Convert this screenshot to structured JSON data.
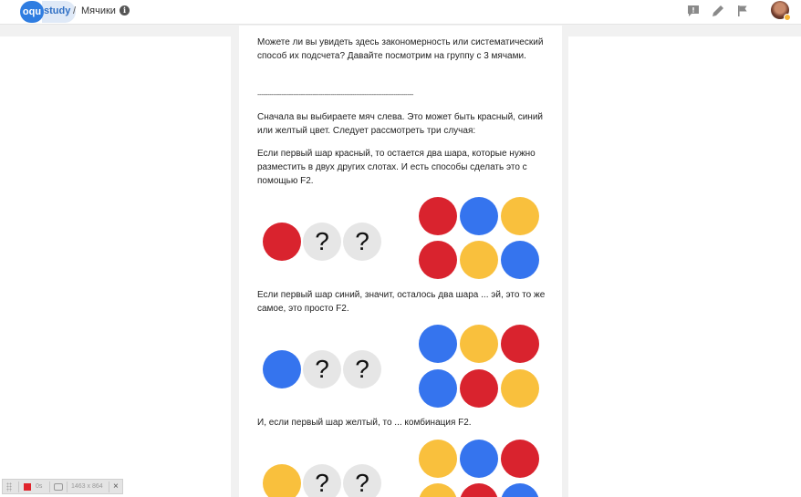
{
  "header": {
    "logo_oqu": "oqu",
    "logo_study": "study",
    "breadcrumb_sep": "/",
    "page_title": "Мячики",
    "info_label": "i"
  },
  "article": {
    "p1": "Можете ли вы увидеть здесь закономерность или систематический способ их подсчета? Давайте посмотрим на группу с 3 мячами.",
    "divider": "-------------------------------------------------------------------------------",
    "p2": "Сначала вы выбираете мяч слева. Это может быть красный, синий или желтый цвет. Следует рассмотреть три случая:",
    "p3": "Если первый шар красный, то остается два шара, которые нужно разместить в двух других слотах. И есть способы сделать это с помощью F2.",
    "p4": "Если первый шар синий, значит, осталось два шара ... эй, это то же самое, это просто F2.",
    "p5": "И, если первый шар желтый, то ... комбинация F2.",
    "question_mark": "?"
  },
  "statusbar": {
    "time": "0s",
    "size": "1463 x 864",
    "close": "×"
  },
  "colors": {
    "red": "#d9232e",
    "blue": "#3574ee",
    "yellow": "#f9c03d",
    "brand": "#2f7de1"
  }
}
